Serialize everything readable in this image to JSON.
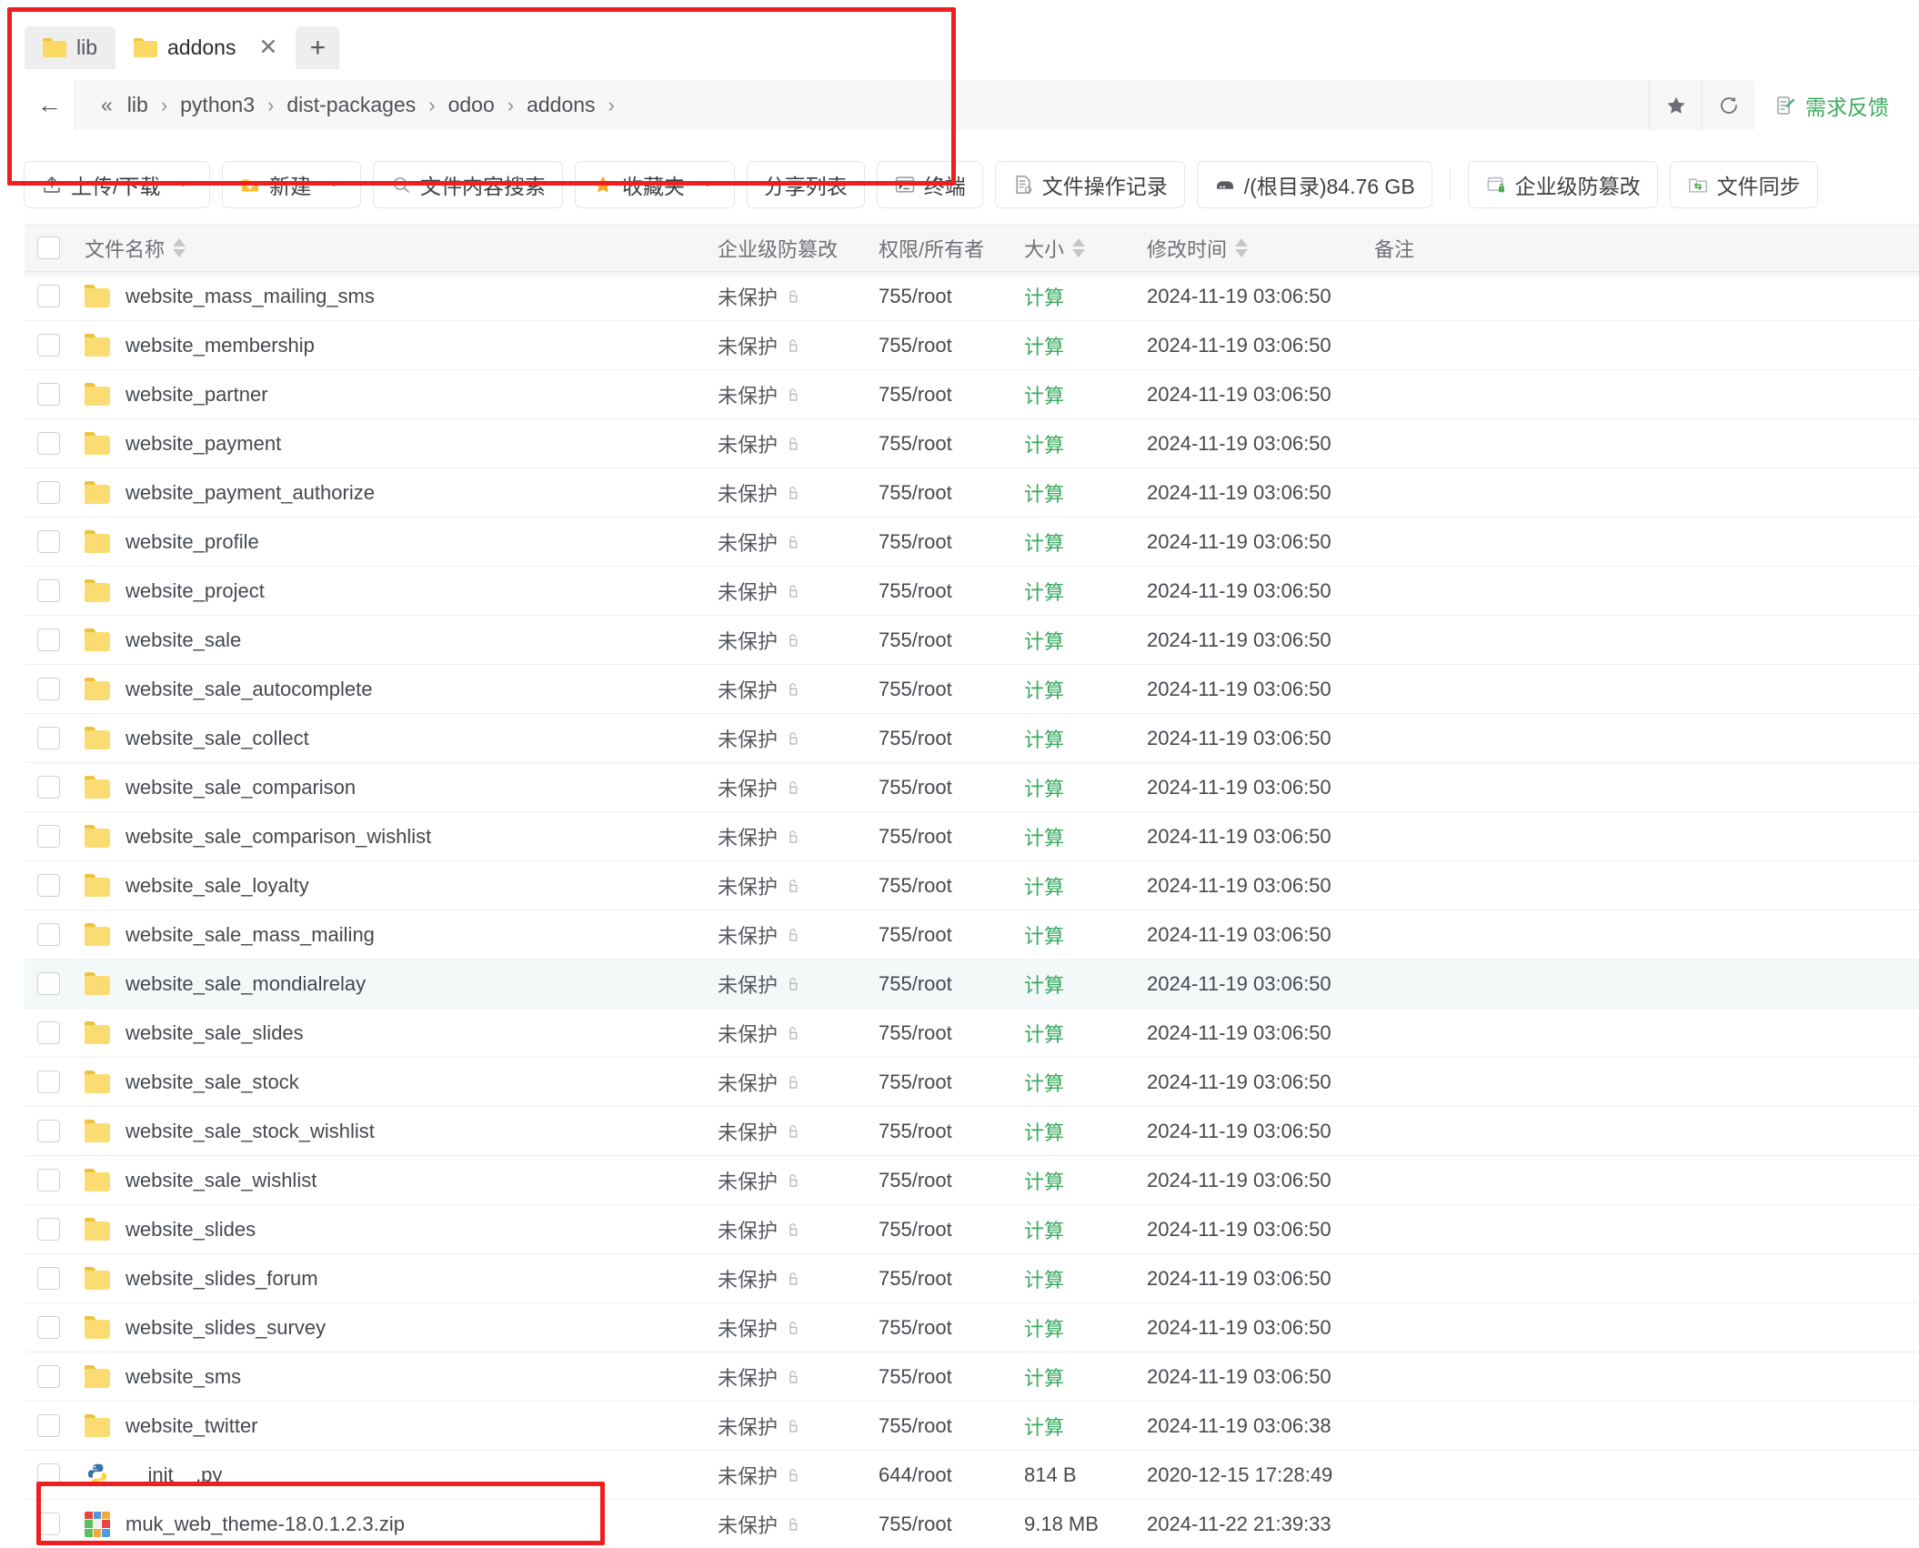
{
  "window": {
    "tabs": [
      {
        "label": "lib",
        "active": false,
        "closable": false,
        "icon": "folder-icon"
      },
      {
        "label": "addons",
        "active": true,
        "closable": true,
        "icon": "folder-icon",
        "close_glyph": "✕"
      }
    ],
    "new_tab_glyph": "+"
  },
  "address": {
    "back_glyph": "←",
    "overflow_glyph": "«",
    "separator": "›",
    "crumbs": [
      "lib",
      "python3",
      "dist-packages",
      "odoo",
      "addons"
    ],
    "star_label": "★",
    "refresh_label": "↻",
    "feedback_label": "需求反馈"
  },
  "toolbar": {
    "buttons": [
      {
        "label": "上传/下载",
        "icon": "upload-icon",
        "caret": true
      },
      {
        "label": "新建",
        "icon": "new-folder-icon",
        "caret": true
      },
      {
        "label": "文件内容搜索",
        "icon": "search-icon",
        "caret": false
      },
      {
        "label": "收藏夹",
        "icon": "star-icon",
        "caret": true
      },
      {
        "label": "分享列表",
        "icon": "none",
        "caret": false
      },
      {
        "label": "终端",
        "icon": "terminal-icon",
        "caret": false
      },
      {
        "label": "文件操作记录",
        "icon": "log-icon",
        "caret": false
      },
      {
        "label": "/(根目录)84.76 GB",
        "icon": "disk-icon",
        "caret": false
      },
      {
        "label": "企业级防篡改",
        "icon": "shield-lock-icon",
        "caret": false
      },
      {
        "label": "文件同步",
        "icon": "sync-folder-icon",
        "caret": false
      }
    ]
  },
  "table": {
    "headers": {
      "name": "文件名称",
      "protection": "企业级防篡改",
      "permission": "权限/所有者",
      "size": "大小",
      "modified": "修改时间",
      "note": "备注"
    },
    "protection_value": "未保护",
    "size_calc_label": "计算",
    "rows": [
      {
        "name": "website_mass_mailing_sms",
        "icon": "folder-icon",
        "protection": "未保护",
        "permission": "755/root",
        "size": "计算",
        "size_is_link": true,
        "modified": "2024-11-19 03:06:50",
        "note": "",
        "highlighted": false
      },
      {
        "name": "website_membership",
        "icon": "folder-icon",
        "protection": "未保护",
        "permission": "755/root",
        "size": "计算",
        "size_is_link": true,
        "modified": "2024-11-19 03:06:50",
        "note": "",
        "highlighted": false
      },
      {
        "name": "website_partner",
        "icon": "folder-icon",
        "protection": "未保护",
        "permission": "755/root",
        "size": "计算",
        "size_is_link": true,
        "modified": "2024-11-19 03:06:50",
        "note": "",
        "highlighted": false
      },
      {
        "name": "website_payment",
        "icon": "folder-icon",
        "protection": "未保护",
        "permission": "755/root",
        "size": "计算",
        "size_is_link": true,
        "modified": "2024-11-19 03:06:50",
        "note": "",
        "highlighted": false
      },
      {
        "name": "website_payment_authorize",
        "icon": "folder-icon",
        "protection": "未保护",
        "permission": "755/root",
        "size": "计算",
        "size_is_link": true,
        "modified": "2024-11-19 03:06:50",
        "note": "",
        "highlighted": false
      },
      {
        "name": "website_profile",
        "icon": "folder-icon",
        "protection": "未保护",
        "permission": "755/root",
        "size": "计算",
        "size_is_link": true,
        "modified": "2024-11-19 03:06:50",
        "note": "",
        "highlighted": false
      },
      {
        "name": "website_project",
        "icon": "folder-icon",
        "protection": "未保护",
        "permission": "755/root",
        "size": "计算",
        "size_is_link": true,
        "modified": "2024-11-19 03:06:50",
        "note": "",
        "highlighted": false
      },
      {
        "name": "website_sale",
        "icon": "folder-icon",
        "protection": "未保护",
        "permission": "755/root",
        "size": "计算",
        "size_is_link": true,
        "modified": "2024-11-19 03:06:50",
        "note": "",
        "highlighted": false
      },
      {
        "name": "website_sale_autocomplete",
        "icon": "folder-icon",
        "protection": "未保护",
        "permission": "755/root",
        "size": "计算",
        "size_is_link": true,
        "modified": "2024-11-19 03:06:50",
        "note": "",
        "highlighted": false
      },
      {
        "name": "website_sale_collect",
        "icon": "folder-icon",
        "protection": "未保护",
        "permission": "755/root",
        "size": "计算",
        "size_is_link": true,
        "modified": "2024-11-19 03:06:50",
        "note": "",
        "highlighted": false
      },
      {
        "name": "website_sale_comparison",
        "icon": "folder-icon",
        "protection": "未保护",
        "permission": "755/root",
        "size": "计算",
        "size_is_link": true,
        "modified": "2024-11-19 03:06:50",
        "note": "",
        "highlighted": false
      },
      {
        "name": "website_sale_comparison_wishlist",
        "icon": "folder-icon",
        "protection": "未保护",
        "permission": "755/root",
        "size": "计算",
        "size_is_link": true,
        "modified": "2024-11-19 03:06:50",
        "note": "",
        "highlighted": false
      },
      {
        "name": "website_sale_loyalty",
        "icon": "folder-icon",
        "protection": "未保护",
        "permission": "755/root",
        "size": "计算",
        "size_is_link": true,
        "modified": "2024-11-19 03:06:50",
        "note": "",
        "highlighted": false
      },
      {
        "name": "website_sale_mass_mailing",
        "icon": "folder-icon",
        "protection": "未保护",
        "permission": "755/root",
        "size": "计算",
        "size_is_link": true,
        "modified": "2024-11-19 03:06:50",
        "note": "",
        "highlighted": false
      },
      {
        "name": "website_sale_mondialrelay",
        "icon": "folder-icon",
        "protection": "未保护",
        "permission": "755/root",
        "size": "计算",
        "size_is_link": true,
        "modified": "2024-11-19 03:06:50",
        "note": "",
        "highlighted": true
      },
      {
        "name": "website_sale_slides",
        "icon": "folder-icon",
        "protection": "未保护",
        "permission": "755/root",
        "size": "计算",
        "size_is_link": true,
        "modified": "2024-11-19 03:06:50",
        "note": "",
        "highlighted": false
      },
      {
        "name": "website_sale_stock",
        "icon": "folder-icon",
        "protection": "未保护",
        "permission": "755/root",
        "size": "计算",
        "size_is_link": true,
        "modified": "2024-11-19 03:06:50",
        "note": "",
        "highlighted": false
      },
      {
        "name": "website_sale_stock_wishlist",
        "icon": "folder-icon",
        "protection": "未保护",
        "permission": "755/root",
        "size": "计算",
        "size_is_link": true,
        "modified": "2024-11-19 03:06:50",
        "note": "",
        "highlighted": false
      },
      {
        "name": "website_sale_wishlist",
        "icon": "folder-icon",
        "protection": "未保护",
        "permission": "755/root",
        "size": "计算",
        "size_is_link": true,
        "modified": "2024-11-19 03:06:50",
        "note": "",
        "highlighted": false
      },
      {
        "name": "website_slides",
        "icon": "folder-icon",
        "protection": "未保护",
        "permission": "755/root",
        "size": "计算",
        "size_is_link": true,
        "modified": "2024-11-19 03:06:50",
        "note": "",
        "highlighted": false
      },
      {
        "name": "website_slides_forum",
        "icon": "folder-icon",
        "protection": "未保护",
        "permission": "755/root",
        "size": "计算",
        "size_is_link": true,
        "modified": "2024-11-19 03:06:50",
        "note": "",
        "highlighted": false
      },
      {
        "name": "website_slides_survey",
        "icon": "folder-icon",
        "protection": "未保护",
        "permission": "755/root",
        "size": "计算",
        "size_is_link": true,
        "modified": "2024-11-19 03:06:50",
        "note": "",
        "highlighted": false
      },
      {
        "name": "website_sms",
        "icon": "folder-icon",
        "protection": "未保护",
        "permission": "755/root",
        "size": "计算",
        "size_is_link": true,
        "modified": "2024-11-19 03:06:50",
        "note": "",
        "highlighted": false
      },
      {
        "name": "website_twitter",
        "icon": "folder-icon",
        "protection": "未保护",
        "permission": "755/root",
        "size": "计算",
        "size_is_link": true,
        "modified": "2024-11-19 03:06:38",
        "note": "",
        "highlighted": false
      },
      {
        "name": "__init__.py",
        "icon": "python-file-icon",
        "protection": "未保护",
        "permission": "644/root",
        "size": "814 B",
        "size_is_link": false,
        "modified": "2020-12-15 17:28:49",
        "note": "",
        "highlighted": false
      },
      {
        "name": "muk_web_theme-18.0.1.2.3.zip",
        "icon": "zip-file-icon",
        "protection": "未保护",
        "permission": "755/root",
        "size": "9.18 MB",
        "size_is_link": false,
        "modified": "2024-11-22 21:39:33",
        "note": "",
        "highlighted": false
      }
    ]
  },
  "annotations": {
    "highlight_color": "#f01f1f",
    "boxes": [
      "tab-and-address-bar",
      "zip-file-row-name"
    ]
  },
  "colors": {
    "accent_green": "#3aaa5f",
    "folder_yellow": "#fbdc72",
    "row_highlight": "#f2f9f8",
    "header_bg": "#f6f6f6"
  }
}
